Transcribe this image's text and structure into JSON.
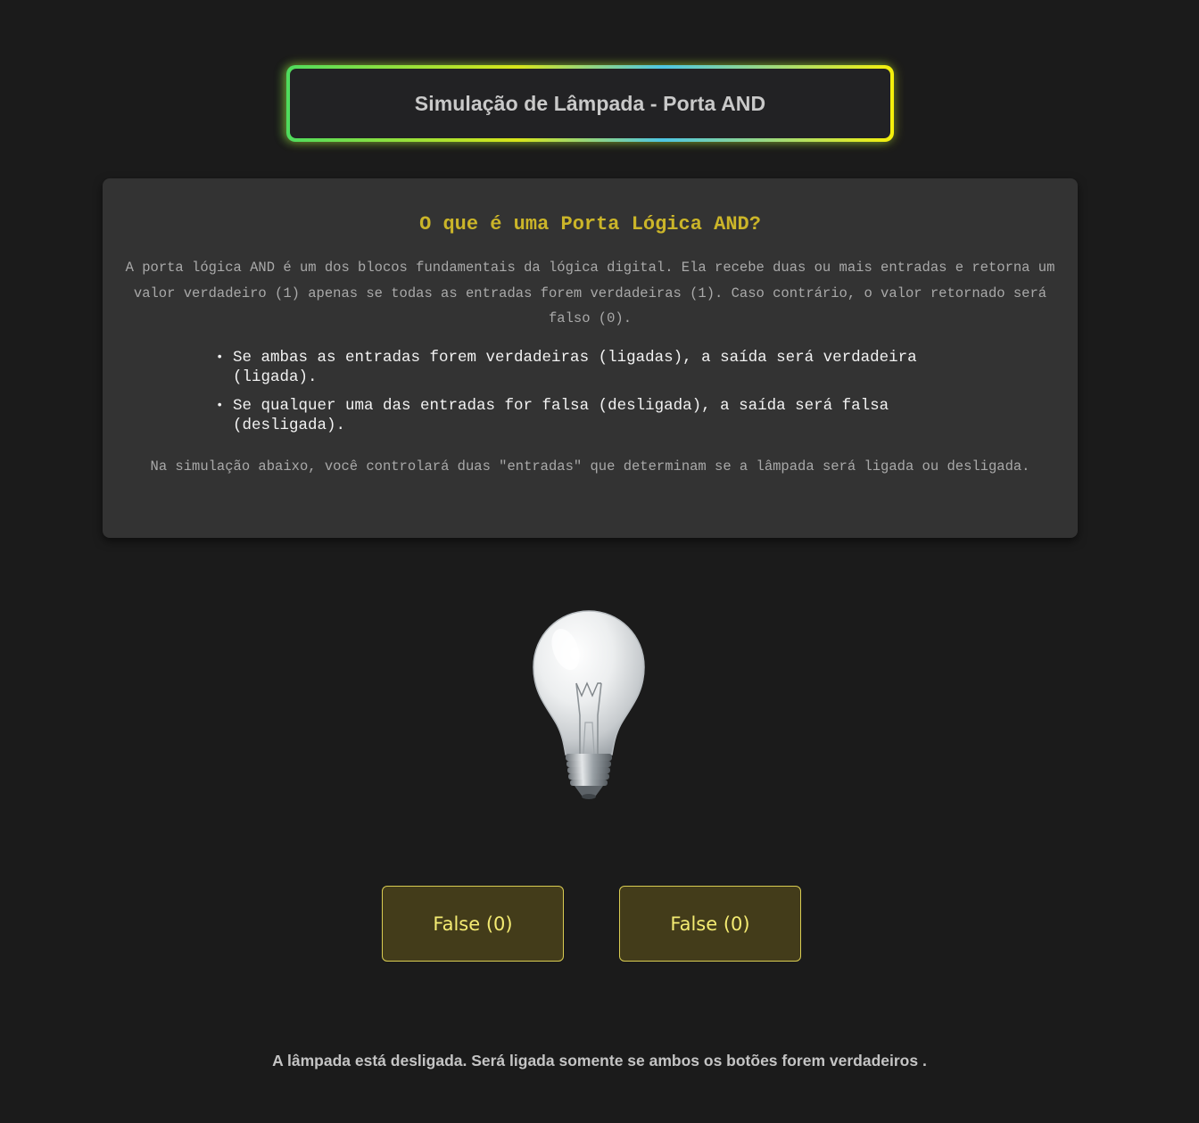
{
  "header": {
    "title": "Simulação de Lâmpada - Porta AND"
  },
  "info": {
    "heading": "O que é uma Porta Lógica AND?",
    "intro": "A porta lógica AND é um dos blocos fundamentais da lógica digital. Ela recebe duas ou mais entradas e retorna um valor verdadeiro (1) apenas se todas as entradas forem verdadeiras (1). Caso contrário, o valor retornado será falso (0).",
    "bullets": [
      "Se ambas as entradas forem verdadeiras (ligadas), a saída será verdadeira (ligada).",
      "Se qualquer uma das entradas for falsa (desligada), a saída será falsa (desligada)."
    ],
    "outro": "Na simulação abaixo, você controlará duas \"entradas\" que determinam se a lâmpada será ligada ou desligada."
  },
  "lamp": {
    "icon": "lightbulb-icon",
    "state": "off"
  },
  "inputs": [
    {
      "label": "False (0)"
    },
    {
      "label": "False (0)"
    }
  ],
  "status": {
    "text": "A lâmpada está desligada. Será ligada somente se ambos os botões forem verdadeiros ."
  },
  "colors": {
    "background": "#1b1b1b",
    "card": "#333333",
    "heading_accent": "#cbb529",
    "button_fill": "#433c1a",
    "button_border": "#d9cc52",
    "button_text": "#f4eb72"
  }
}
